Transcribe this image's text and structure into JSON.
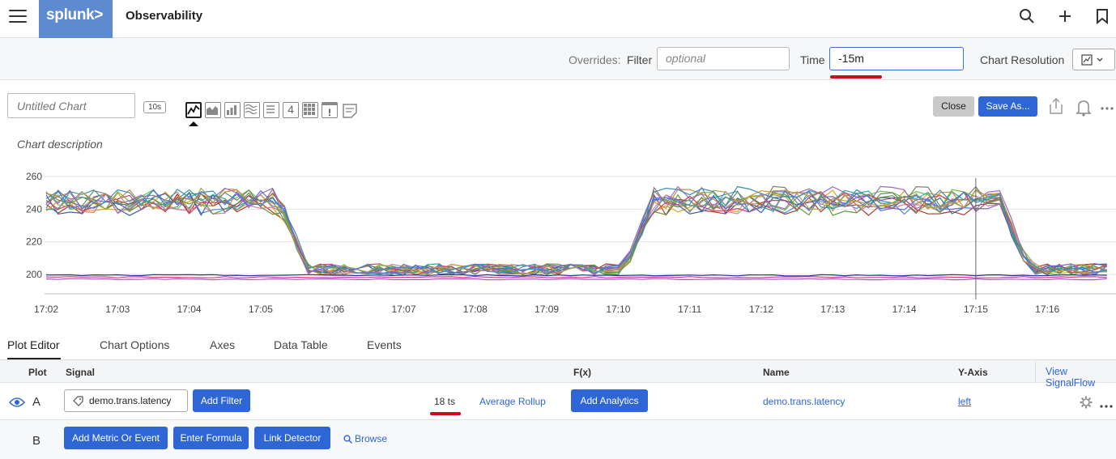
{
  "app": {
    "logo_text": "splunk>",
    "title": "Observability"
  },
  "overrides": {
    "overrides_label": "Overrides:",
    "filter_label": "Filter",
    "filter_placeholder": "optional",
    "time_label": "Time",
    "time_value": "-15m",
    "chart_resolution_label": "Chart Resolution"
  },
  "chart_header": {
    "name_placeholder": "Untitled Chart",
    "resolution_badge": "10s",
    "close_label": "Close",
    "save_as_label": "Save As...",
    "description": "Chart description",
    "viz_types": [
      "line-chart-icon",
      "area-chart-icon",
      "column-chart-icon",
      "histogram-icon",
      "list-icon",
      "single-value-icon",
      "heatmap-icon",
      "event-feed-icon",
      "text-note-icon"
    ],
    "single_value_glyph": "4",
    "event_feed_glyph": "!"
  },
  "chart_data": {
    "type": "line",
    "x_ticks": [
      "17:02",
      "17:03",
      "17:04",
      "17:05",
      "17:06",
      "17:07",
      "17:08",
      "17:09",
      "17:10",
      "17:11",
      "17:12",
      "17:13",
      "17:14",
      "17:15",
      "17:16"
    ],
    "y_ticks": [
      200,
      220,
      240,
      260
    ],
    "ylim": [
      188,
      264
    ],
    "grid": true,
    "cursor_time": "17:15",
    "series_count": 18,
    "series_colors": [
      "#a83c27",
      "#4f8bd6",
      "#e0a020",
      "#6cbf3f",
      "#9a6bc4",
      "#3e5fa8",
      "#d87aa0",
      "#2fa59a",
      "#c98a3a",
      "#7d7d7d",
      "#5a9c3a",
      "#c04a6a",
      "#6a6ad6",
      "#b0a050",
      "#3a8ac0",
      "#a05ad0",
      "#d04080",
      "#2a2aa0"
    ],
    "segments": [
      {
        "from": "17:02",
        "to": "17:05",
        "approx_value": 245
      },
      {
        "from": "17:05:30",
        "to": "17:10:15",
        "approx_value": 203
      },
      {
        "from": "17:10:30",
        "to": "17:15:15",
        "approx_value": 245
      },
      {
        "from": "17:15:30",
        "to": "17:17",
        "approx_value": 203
      }
    ],
    "low_series_value": 197
  },
  "tabs": [
    "Plot Editor",
    "Chart Options",
    "Axes",
    "Data Table",
    "Events"
  ],
  "plot_table": {
    "headers": {
      "plot": "Plot",
      "signal": "Signal",
      "fx": "F(x)",
      "name": "Name",
      "y_axis": "Y-Axis",
      "view_signalflow": "View SignalFlow"
    },
    "row_a": {
      "letter": "A",
      "signal": "demo.trans.latency",
      "add_filter": "Add Filter",
      "ts_count": "18 ts",
      "rollup": "Average Rollup",
      "add_analytics": "Add Analytics",
      "name": "demo.trans.latency",
      "y_axis": "left"
    },
    "row_b": {
      "letter": "B",
      "add_metric": "Add Metric Or Event",
      "enter_formula": "Enter Formula",
      "link_detector": "Link Detector",
      "browse": "Browse"
    }
  }
}
